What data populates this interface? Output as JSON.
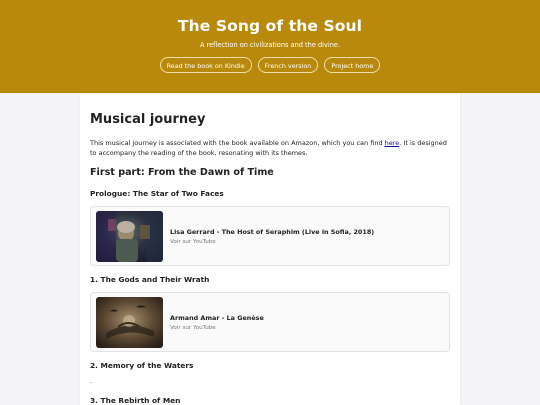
{
  "header": {
    "title": "The Song of the Soul",
    "subtitle": "A reflection on civilizations and the divine.",
    "links": [
      "Read the book on Kindle",
      "French version",
      "Project home"
    ]
  },
  "main": {
    "page_title": "Musical journey",
    "intro_before": "This musical journey is associated with the book available on Amazon, which you can find ",
    "intro_link": "here",
    "intro_after": ". It is designed to accompany the reading of the book, resonating with its themes.",
    "part_title": "First part: From the Dawn of Time",
    "sections": [
      {
        "heading": "Prologue: The Star of Two Faces",
        "video_title": "Lisa Gerrard - The Host of Seraphim (Live in Sofia, 2018)",
        "video_source": "Voir sur YouTube"
      },
      {
        "heading": "1. The Gods and Their Wrath",
        "video_title": "Armand Amar - La Genèse",
        "video_source": "Voir sur YouTube"
      },
      {
        "heading": "2. Memory of the Waters",
        "body": "."
      },
      {
        "heading": "3. The Rebirth of Men"
      }
    ]
  },
  "colors": {
    "banner": "#b8890b",
    "link": "#1a0dab",
    "page_bg": "#f4f4f6"
  },
  "icons": [
    "video-thumbnail-1",
    "video-thumbnail-2"
  ]
}
